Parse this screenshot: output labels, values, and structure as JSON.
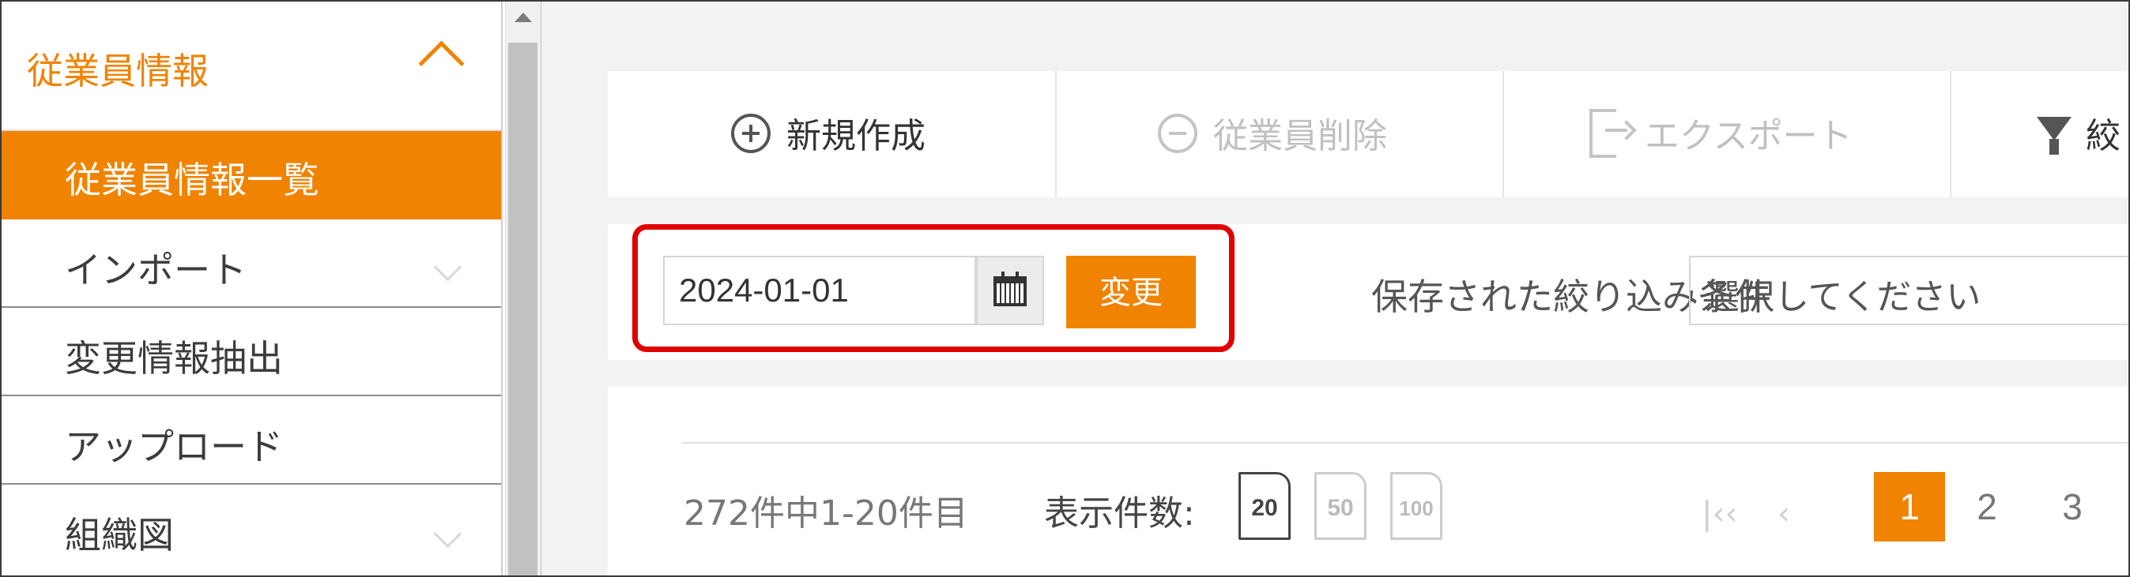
{
  "sidebar": {
    "section_label": "従業員情報",
    "items": [
      {
        "label": "従業員情報一覧"
      },
      {
        "label": "インポート"
      },
      {
        "label": "変更情報抽出"
      },
      {
        "label": "アップロード"
      },
      {
        "label": "組織図"
      }
    ]
  },
  "toolbar": {
    "new_label": "新規作成",
    "delete_label": "従業員削除",
    "export_label": "エクスポート",
    "filter_label": "絞"
  },
  "filter": {
    "date_value": "2024-01-01",
    "change_label": "変更",
    "saved_label": "保存された絞り込み条件",
    "saved_select_value": "選択してください"
  },
  "list": {
    "count_text": "272件中1-20件目",
    "per_page_label": "表示件数:",
    "per_page_options": [
      "20",
      "50",
      "100"
    ],
    "pages": [
      "1",
      "2",
      "3"
    ],
    "first_icon": "double-chevron-left-icon",
    "prev_icon": "chevron-left-icon"
  },
  "colors": {
    "accent": "#f08300",
    "highlight": "#e00000"
  }
}
